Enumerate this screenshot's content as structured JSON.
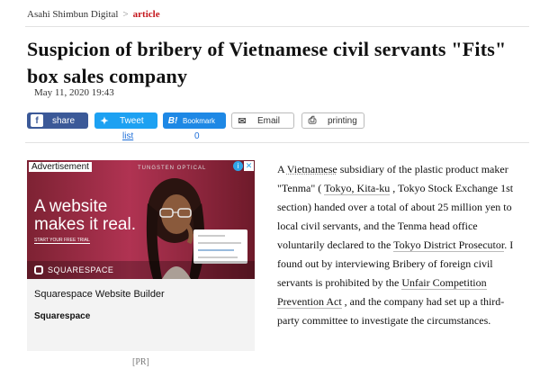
{
  "breadcrumb": {
    "home": "Asahi Shimbun Digital",
    "separator": ">",
    "current": "article"
  },
  "headline": "Suspicion of bribery of Vietnamese civil servants \"Fits\" box sales company",
  "date": "May 11, 2020 19:43",
  "share": {
    "facebook": {
      "icon": "f",
      "label": "share"
    },
    "twitter": {
      "icon": "✦",
      "label": "Tweet",
      "count_label": "list"
    },
    "hatena": {
      "icon": "B!",
      "label": "Bookmark",
      "count": "0"
    },
    "email": {
      "icon": "✉",
      "label": "Email"
    },
    "print": {
      "icon": "⎙",
      "label": "printing"
    }
  },
  "ad": {
    "badge": "Advertisement",
    "top_brand": "TUNGSTEN OPTICAL",
    "info_icon": "i",
    "close_icon": "✕",
    "headline_line1": "A website",
    "headline_line2": "makes it real.",
    "cta": "START YOUR FREE TRIAL",
    "logo": "SQUARESPACE",
    "title": "Squarespace Website Builder",
    "advertiser": "Squarespace",
    "pr_label": "[PR]"
  },
  "article": {
    "p1_a": "A ",
    "p1_vietnamese": "Vietnamese",
    "p1_b": " subsidiary of the ",
    "p1_plastic": "plastic",
    "p1_c": " product maker \"Tenma\" ( ",
    "p1_tokyo": "Tokyo, Kita-ku",
    "p1_d": " , Tokyo Stock Exchange 1st section) handed over a total of about 25 million yen to local civil servants, and the Tenma head office voluntarily declared to the ",
    "p1_prosecutor": "Tokyo District Prosecutor",
    "p1_e": ". I found out by interviewing Bribery of foreign civil servants is prohibited by the ",
    "p1_act": "Unfair Competition Prevention Act",
    "p1_f": " , and the company had set up a third-party committee to investigate the circumstances."
  }
}
